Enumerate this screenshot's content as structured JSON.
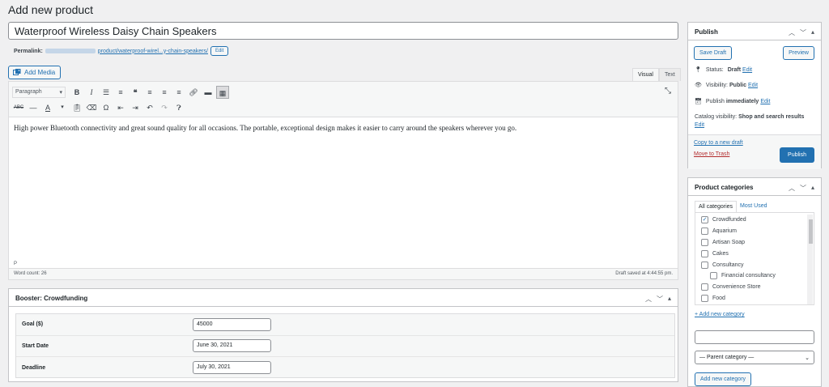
{
  "page_title": "Add new product",
  "product_title": "Waterproof Wireless Daisy Chain Speakers",
  "permalink": {
    "label": "Permalink:",
    "url_text": "product/waterproof-wirel...y-chain-speakers/",
    "edit_label": "Edit"
  },
  "add_media_label": "Add Media",
  "editor": {
    "tabs": [
      "Visual",
      "Text"
    ],
    "active_tab": "Visual",
    "format_select": "Paragraph",
    "content": "High power Bluetooth connectivity and great sound quality for all occasions. The portable, exceptional design makes it easier to carry around the speakers wherever you go.",
    "path": "P",
    "word_count": "Word count: 26",
    "draft_saved": "Draft saved at 4:44:55 pm."
  },
  "crowdfunding": {
    "title": "Booster: Crowdfunding",
    "fields": [
      {
        "label": "Goal ($)",
        "value": "45000"
      },
      {
        "label": "Start Date",
        "value": "June 30, 2021"
      },
      {
        "label": "Deadline",
        "value": "July 30, 2021"
      }
    ]
  },
  "publish": {
    "title": "Publish",
    "save_draft": "Save Draft",
    "preview": "Preview",
    "status_label": "Status:",
    "status_value": "Draft",
    "visibility_label": "Visibility:",
    "visibility_value": "Public",
    "publish_label": "Publish",
    "publish_value": "immediately",
    "catalog_label": "Catalog visibility:",
    "catalog_value": "Shop and search results",
    "edit": "Edit",
    "copy_draft": "Copy to a new draft",
    "move_trash": "Move to Trash",
    "publish_button": "Publish"
  },
  "categories": {
    "title": "Product categories",
    "tabs": [
      "All categories",
      "Most Used"
    ],
    "items": [
      {
        "label": "Crowdfunded",
        "checked": true
      },
      {
        "label": "Aquarium",
        "checked": false
      },
      {
        "label": "Artisan Soap",
        "checked": false
      },
      {
        "label": "Cakes",
        "checked": false
      },
      {
        "label": "Consultancy",
        "checked": false
      },
      {
        "label": "Financial consultancy",
        "checked": false
      },
      {
        "label": "Convenience Store",
        "checked": false
      },
      {
        "label": "Food",
        "checked": false
      }
    ],
    "add_new_link": "+ Add new category",
    "parent_select": "— Parent category —",
    "add_button": "Add new category"
  },
  "colors": {
    "accent": "#2271b1",
    "trash": "#b32d2e",
    "border": "#c3c4c7"
  }
}
